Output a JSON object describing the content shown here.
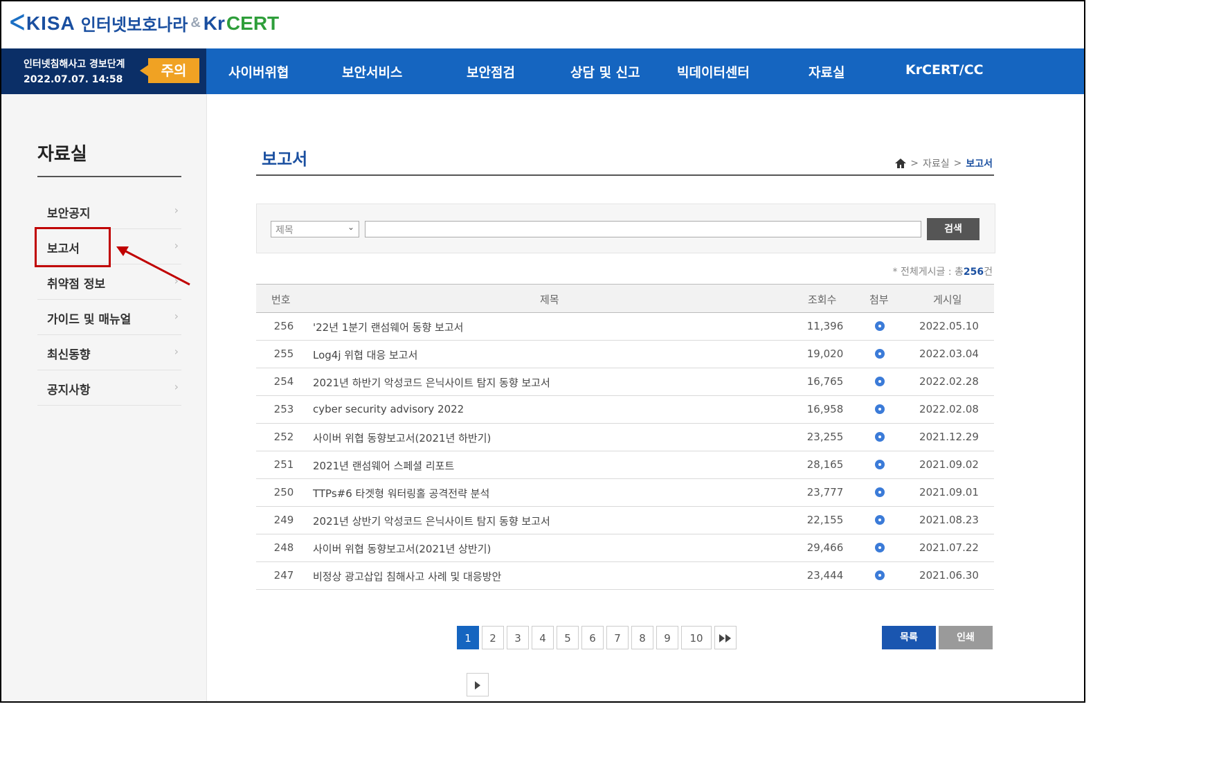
{
  "header": {
    "logo_kisa": "KISA",
    "logo_ko": "인터넷보호나라",
    "logo_amp": "&",
    "logo_kr": "Kr",
    "logo_cert": "CERT"
  },
  "alert": {
    "label": "인터넷침해사고 경보단계",
    "datetime": "2022.07.07. 14:58",
    "level": "주의",
    "level_color": "#f0a223"
  },
  "nav": {
    "items": [
      "사이버위협",
      "보안서비스",
      "보안점검",
      "상담 및 신고",
      "빅데이터센터",
      "자료실",
      "KrCERT/CC"
    ]
  },
  "sidebar": {
    "title": "자료실",
    "items": [
      {
        "label": "보안공지"
      },
      {
        "label": "보고서"
      },
      {
        "label": "취약점 정보"
      },
      {
        "label": "가이드 및 매뉴얼"
      },
      {
        "label": "최신동향"
      },
      {
        "label": "공지사항"
      }
    ],
    "selected_index": 1,
    "chevron_icon": "chevron-right-icon"
  },
  "main": {
    "title": "보고서",
    "breadcrumb": {
      "home_icon": "home-icon",
      "sep": ">",
      "level1": "자료실",
      "level2": "보고서"
    }
  },
  "search": {
    "select_value": "제목",
    "input_value": "",
    "button_label": "검색"
  },
  "total": {
    "prefix": "* 전체게시글 : 총",
    "count": "256",
    "suffix": "건"
  },
  "table": {
    "headers": {
      "no": "번호",
      "title": "제목",
      "views": "조회수",
      "attach": "첨부",
      "date": "게시일"
    },
    "rows": [
      {
        "no": "256",
        "title": "'22년 1분기 랜섬웨어 동향 보고서",
        "views": "11,396",
        "date": "2022.05.10"
      },
      {
        "no": "255",
        "title": "Log4j 위협 대응 보고서",
        "views": "19,020",
        "date": "2022.03.04"
      },
      {
        "no": "254",
        "title": "2021년 하반기 악성코드 은닉사이트 탐지 동향 보고서",
        "views": "16,765",
        "date": "2022.02.28"
      },
      {
        "no": "253",
        "title": "cyber security advisory 2022",
        "views": "16,958",
        "date": "2022.02.08"
      },
      {
        "no": "252",
        "title": "사이버 위협 동향보고서(2021년 하반기)",
        "views": "23,255",
        "date": "2021.12.29"
      },
      {
        "no": "251",
        "title": "2021년 랜섬웨어 스페셜 리포트",
        "views": "28,165",
        "date": "2021.09.02"
      },
      {
        "no": "250",
        "title": "TTPs#6 타겟형 워터링홀 공격전략 분석",
        "views": "23,777",
        "date": "2021.09.01"
      },
      {
        "no": "249",
        "title": "2021년 상반기 악성코드 은닉사이트 탐지 동향 보고서",
        "views": "22,155",
        "date": "2021.08.23"
      },
      {
        "no": "248",
        "title": "사이버 위협 동향보고서(2021년 상반기)",
        "views": "29,466",
        "date": "2021.07.22"
      },
      {
        "no": "247",
        "title": "비정상 광고삽입 침해사고 사례 및 대응방안",
        "views": "23,444",
        "date": "2021.06.30"
      }
    ],
    "attach_icon": "attachment-icon"
  },
  "pagination": {
    "pages": [
      "1",
      "2",
      "3",
      "4",
      "5",
      "6",
      "7",
      "8",
      "9",
      "10"
    ],
    "current": "1",
    "next_icon": "next-page-icon",
    "last_icon": "last-page-icon"
  },
  "actions": {
    "list_label": "목록",
    "print_label": "인쇄"
  },
  "colors": {
    "nav_bg": "#1565c0",
    "alert_bg": "#0b2f67",
    "accent": "#1a4fa0",
    "highlight": "#c00000"
  }
}
